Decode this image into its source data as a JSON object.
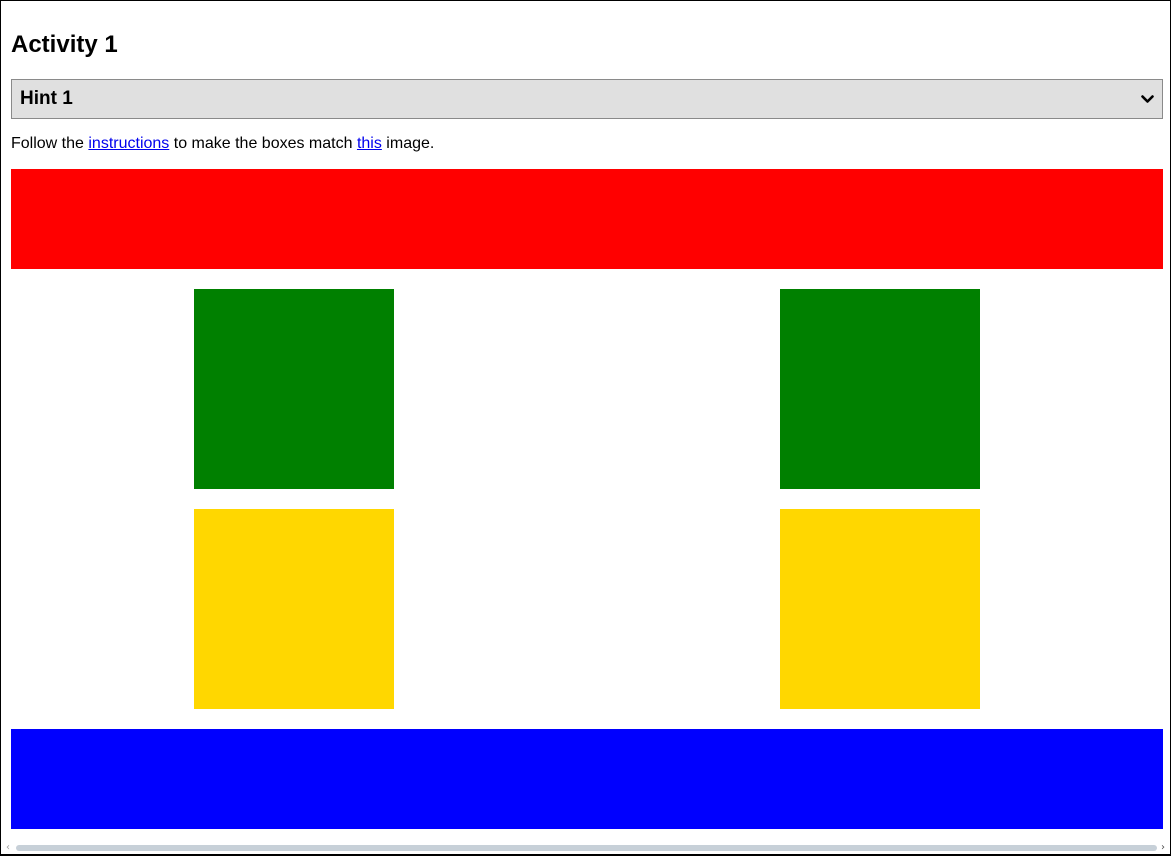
{
  "page": {
    "title": "Activity 1"
  },
  "hint_select": {
    "selected": "Hint 1",
    "icon": "chevron-down-icon"
  },
  "instructions": {
    "prefix": "Follow the ",
    "link1": "instructions",
    "middle": " to make the boxes match ",
    "link2": "this",
    "suffix": " image."
  },
  "boxes": {
    "top_bar_color": "#ff0000",
    "green_color": "#008000",
    "yellow_color": "#ffd700",
    "bottom_bar_color": "#0000ff"
  },
  "scrollbar": {
    "left_arrow": "‹",
    "right_arrow": "›"
  }
}
